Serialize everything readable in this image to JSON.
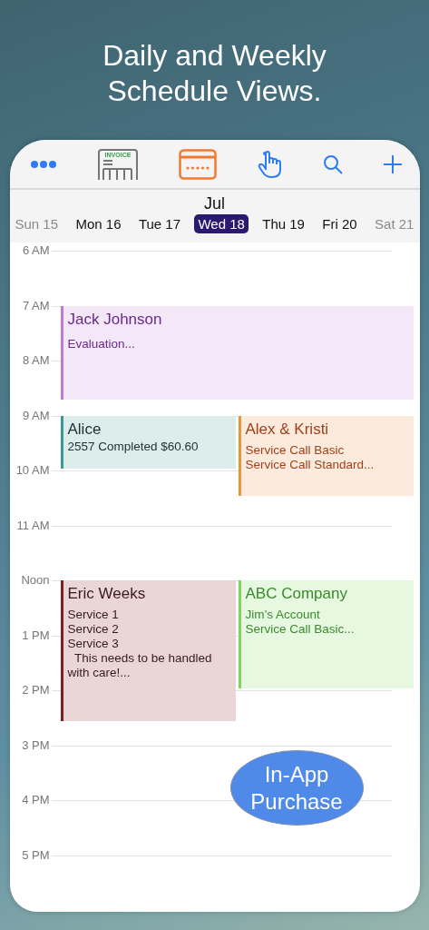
{
  "headline": "Daily and Weekly\nSchedule Views.",
  "toolbar": [
    {
      "kind": "more"
    },
    {
      "kind": "invoice",
      "label": "INVOICE"
    },
    {
      "kind": "card"
    },
    {
      "kind": "hand"
    },
    {
      "kind": "search"
    },
    {
      "kind": "add"
    }
  ],
  "month": "Jul",
  "days": [
    {
      "label": "Sun 15",
      "selected": false,
      "dimmed": true
    },
    {
      "label": "Mon 16",
      "selected": false,
      "dimmed": false
    },
    {
      "label": "Tue 17",
      "selected": false,
      "dimmed": false
    },
    {
      "label": "Wed 18",
      "selected": true,
      "dimmed": false
    },
    {
      "label": "Thu 19",
      "selected": false,
      "dimmed": false
    },
    {
      "label": "Fri 20",
      "selected": false,
      "dimmed": false
    },
    {
      "label": "Sat 21",
      "selected": false,
      "dimmed": true
    }
  ],
  "hours": [
    "6 AM",
    "7 AM",
    "8 AM",
    "9 AM",
    "10 AM",
    "11 AM",
    "Noon",
    "1 PM",
    "2 PM",
    "3 PM",
    "4 PM",
    "5 PM"
  ],
  "events": [
    {
      "title": "Jack Johnson",
      "color": "#c07ad8",
      "lines": [
        "Evaluation..."
      ]
    },
    {
      "title": "Alice",
      "color": "#3a9a94",
      "lines": [
        "2557 Completed $60.60"
      ]
    },
    {
      "title": "Alex & Kristi",
      "color": "#f0923a",
      "lines": [
        "Service Call Basic",
        "Service Call Standard..."
      ]
    },
    {
      "title": "Eric Weeks",
      "color": "#8a1c1c",
      "lines": [
        "Service 1",
        "Service 2",
        "Service 3",
        "  This needs to be handled with care!..."
      ]
    },
    {
      "title": "ABC Company",
      "color": "#7ad858",
      "lines": [
        "Jim’s Account",
        "Service Call Basic..."
      ]
    }
  ],
  "purchase_badge": "In-App\nPurchase"
}
